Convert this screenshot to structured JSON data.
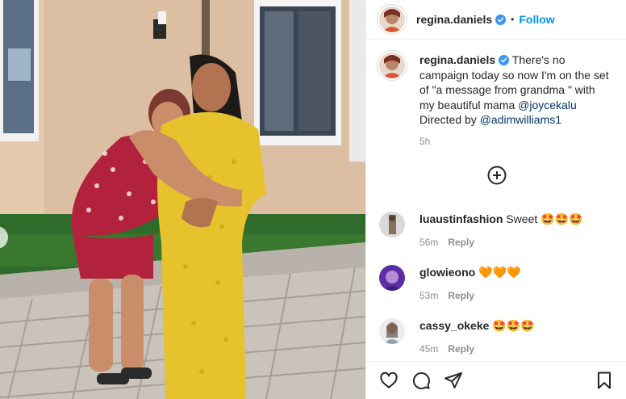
{
  "post": {
    "username": "regina.daniels",
    "follow_label": "Follow",
    "dot": "•",
    "caption_username": "regina.daniels",
    "caption_line1": " There's no campaign today so now I'm on the set of \"a message from grandma \" with my beautiful mama ",
    "caption_mention1": "@joycekalu",
    "caption_line2": "Directed by ",
    "caption_mention2": "@adimwilliams1",
    "time": "5h"
  },
  "comments": [
    {
      "username": "luaustinfashion",
      "text": "Sweet ",
      "emoji": "🤩🤩🤩",
      "time": "56m",
      "reply": "Reply"
    },
    {
      "username": "glowieono",
      "text": "",
      "emoji": "🧡🧡🧡",
      "time": "53m",
      "reply": "Reply"
    },
    {
      "username": "cassy_okeke",
      "text": "",
      "emoji": "🤩🤩🤩",
      "time": "45m",
      "reply": "Reply"
    }
  ],
  "icons": {
    "verified": "verified-badge-icon",
    "more": "add-circle-icon",
    "like": "heart-icon",
    "comment": "comment-bubble-icon",
    "share": "paper-plane-icon",
    "save": "bookmark-icon"
  },
  "colors": {
    "accent": "#0095f6",
    "verified": "#3897f0",
    "muted": "#8e8e8e",
    "mention": "#00376b"
  }
}
